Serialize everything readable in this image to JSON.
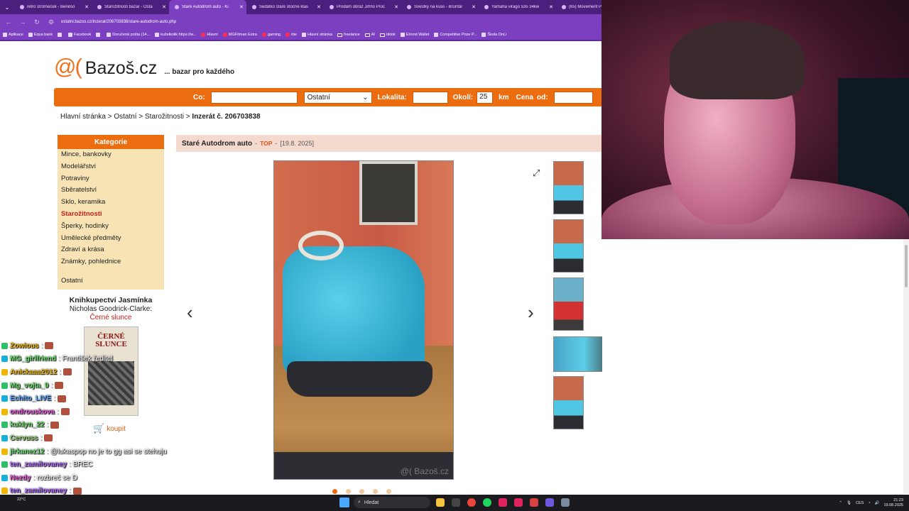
{
  "browser": {
    "tabs": [
      {
        "title": "retro stromeček - Benešo",
        "active": false
      },
      {
        "title": "Starožitnosti bazar - Osta",
        "active": false
      },
      {
        "title": "Staré Autodrom auto - Ki",
        "active": true
      },
      {
        "title": "Sedátko staré otočné klas",
        "active": false
      },
      {
        "title": "Prodám obraz Jiřího Proc",
        "active": false
      },
      {
        "title": "Švestky na kvas - Bruntál",
        "active": false
      },
      {
        "title": "Yamaha virago 535 34kw",
        "active": false
      },
      {
        "title": "(65) Movement Propo",
        "active": false
      }
    ],
    "url": "ostatni.bazos.cz/inzerat/206703838/stare-autodrom-auto.php",
    "bookmarks": [
      {
        "label": "Aplikace",
        "icon": "apps-icon"
      },
      {
        "label": "Equa bank",
        "icon": "bank-icon"
      },
      {
        "label": "",
        "icon": "s-icon"
      },
      {
        "label": "Facebook",
        "icon": "facebook-icon"
      },
      {
        "label": "",
        "icon": "circle-icon"
      },
      {
        "label": "Doručená pošta (14...",
        "icon": "mail-icon"
      },
      {
        "label": "kuželkolik https://w...",
        "icon": "link-icon"
      },
      {
        "label": "Hlavní",
        "icon": "youtube-icon"
      },
      {
        "label": "MGFitman Extra",
        "icon": "youtube-icon"
      },
      {
        "label": "gaming",
        "icon": "youtube-icon"
      },
      {
        "label": "rbe",
        "icon": "youtube-icon"
      },
      {
        "label": "Hlavní stránka",
        "icon": "x-icon"
      },
      {
        "label": "freelance",
        "icon": "folder-icon"
      },
      {
        "label": "AI",
        "icon": "folder-icon"
      },
      {
        "label": "tiktok",
        "icon": "folder-icon"
      },
      {
        "label": "Elrond Wallet",
        "icon": "x-icon"
      },
      {
        "label": "Competitive Prize P...",
        "icon": "link-icon"
      },
      {
        "label": "Škola OnLi",
        "icon": "link-icon"
      }
    ]
  },
  "site": {
    "logo_symbol": "@(",
    "logo_name": "Bazoš.cz",
    "tagline": "... bazar pro každého"
  },
  "search": {
    "co_label": "Co:",
    "category_value": "Ostatní",
    "lokalita_label": "Lokalita:",
    "okoli_label": "Okolí:",
    "okoli_value": "25",
    "km_label": "km",
    "cena_label": "Cena",
    "od_label": "od:"
  },
  "breadcrumb": {
    "home": "Hlavní stránka",
    "sep": ">",
    "level1": "Ostatní",
    "level2": "Starožitnosti",
    "current": "Inzerát č. 206703838"
  },
  "sidebar": {
    "heading": "Kategorie",
    "items": [
      {
        "label": "Mince, bankovky",
        "active": false
      },
      {
        "label": "Modelářství",
        "active": false
      },
      {
        "label": "Potraviny",
        "active": false
      },
      {
        "label": "Sběratelství",
        "active": false
      },
      {
        "label": "Sklo, keramika",
        "active": false
      },
      {
        "label": "Starožitnosti",
        "active": true
      },
      {
        "label": "Šperky, hodinky",
        "active": false
      },
      {
        "label": "Umělecké předměty",
        "active": false
      },
      {
        "label": "Zdraví a krása",
        "active": false
      },
      {
        "label": "Známky, pohlednice",
        "active": false
      }
    ],
    "last_item": "Ostatní"
  },
  "promo": {
    "shop": "Knihkupectví Jasmínka",
    "author": "Nicholas Goodrick-Clarke:",
    "book_link": "Černé slunce",
    "book_cover_title": "ČERNÉ SLUNCE",
    "buy_label": "koupit"
  },
  "ad": {
    "title": "Staré Autodrom auto",
    "top_label": "TOP",
    "dash": "-",
    "date": "[19.8. 2025]",
    "watermark": "@( Bazoš.cz",
    "gallery_count": 5,
    "gallery_active_index": 0
  },
  "chat": [
    {
      "user": "Zowious",
      "msg": "",
      "color": "#f0b800",
      "emote": true
    },
    {
      "user": "MG_girlfriend",
      "msg": ": František ředitel",
      "color": "#6fe06f",
      "emote": false
    },
    {
      "user": "Anickaaa2012",
      "msg": "",
      "color": "#f0b800",
      "emote": true
    },
    {
      "user": "Mg_vojta_9",
      "msg": "",
      "color": "#6fe06f",
      "emote": true
    },
    {
      "user": "Echito_LIVE",
      "msg": "",
      "color": "#5aa6ff",
      "emote": true
    },
    {
      "user": "ondrouskova",
      "msg": "",
      "color": "#e85ad8",
      "emote": true
    },
    {
      "user": "kuklyn_22",
      "msg": "",
      "color": "#6fe06f",
      "emote": true
    },
    {
      "user": "Cervuss",
      "msg": "",
      "color": "#9ad27a",
      "emote": true
    },
    {
      "user": "jirkanez12",
      "msg": ": @lukaspop no je to gg asi se stehuju",
      "color": "#6fe06f",
      "emote": false
    },
    {
      "user": "ten_zamilovaney",
      "msg": ": BREC",
      "color": "#b26bff",
      "emote": false
    },
    {
      "user": "Nezdy",
      "msg": ": rozbreč se D",
      "color": "#e85ad8",
      "emote": false
    },
    {
      "user": "ten_zamilovaney",
      "msg": ":",
      "color": "#b26bff",
      "emote": true
    }
  ],
  "taskbar": {
    "temperature": "22°C",
    "search_placeholder": "Hledat",
    "lang": "CES",
    "time": "21:23",
    "date": "19.08.2025"
  }
}
